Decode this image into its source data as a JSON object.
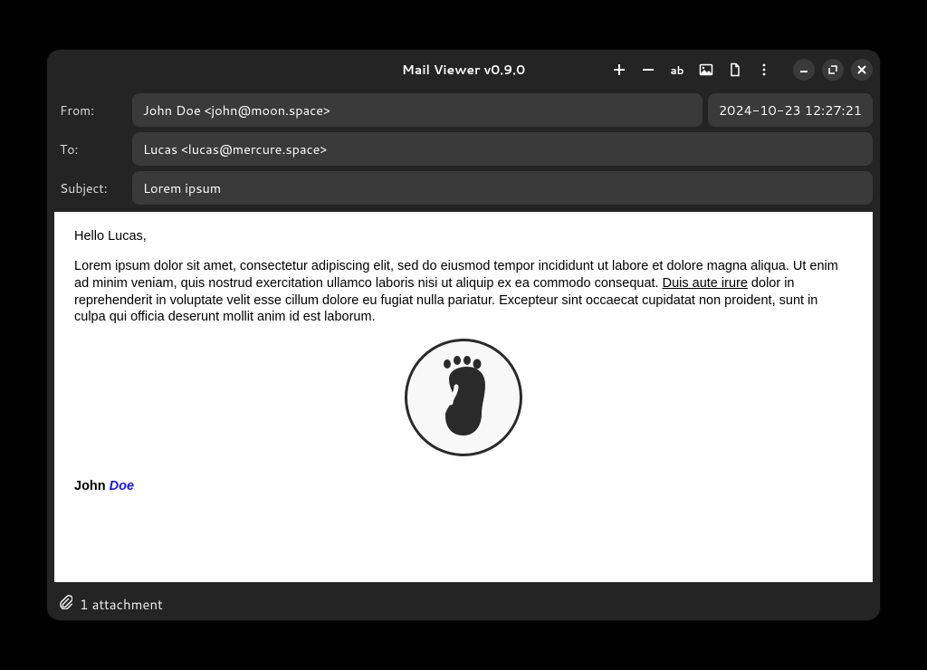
{
  "window": {
    "title": "Mail Viewer v0.9.0"
  },
  "toolbar": {
    "icons": {
      "zoom_in": "plus-icon",
      "zoom_out": "minus-icon",
      "text": "ab-icon",
      "image": "image-icon",
      "document": "document-icon",
      "menu": "menu-icon"
    }
  },
  "window_controls": {
    "minimize": "minimize-icon",
    "maximize": "maximize-icon",
    "close": "close-icon"
  },
  "headers": {
    "from_label": "From:",
    "from_value": "John Doe <john@moon.space>",
    "date_value": "2024-10-23 12:27:21",
    "to_label": "To:",
    "to_value": "Lucas <lucas@mercure.space>",
    "subject_label": "Subject:",
    "subject_value": "Lorem ipsum"
  },
  "body": {
    "greeting": "Hello Lucas,",
    "para_pre": "Lorem ipsum dolor sit amet, consectetur adipiscing elit, sed do eiusmod tempor incididunt ut labore et dolore magna aliqua. Ut enim ad minim veniam, quis nostrud exercitation ullamco laboris nisi ut aliquip ex ea commodo consequat. ",
    "para_link": "Duis aute irure",
    "para_post": " dolor in reprehenderit in voluptate velit esse cillum dolore eu fugiat nulla pariatur. Excepteur sint occaecat cupidatat non proident, sunt in culpa qui officia deserunt mollit anim id est laborum.",
    "signature_first": "John",
    "signature_last": "Doe",
    "logo_icon": "foot-icon"
  },
  "footer": {
    "attachment_icon": "paperclip-icon",
    "attachment_text": "1 attachment"
  }
}
